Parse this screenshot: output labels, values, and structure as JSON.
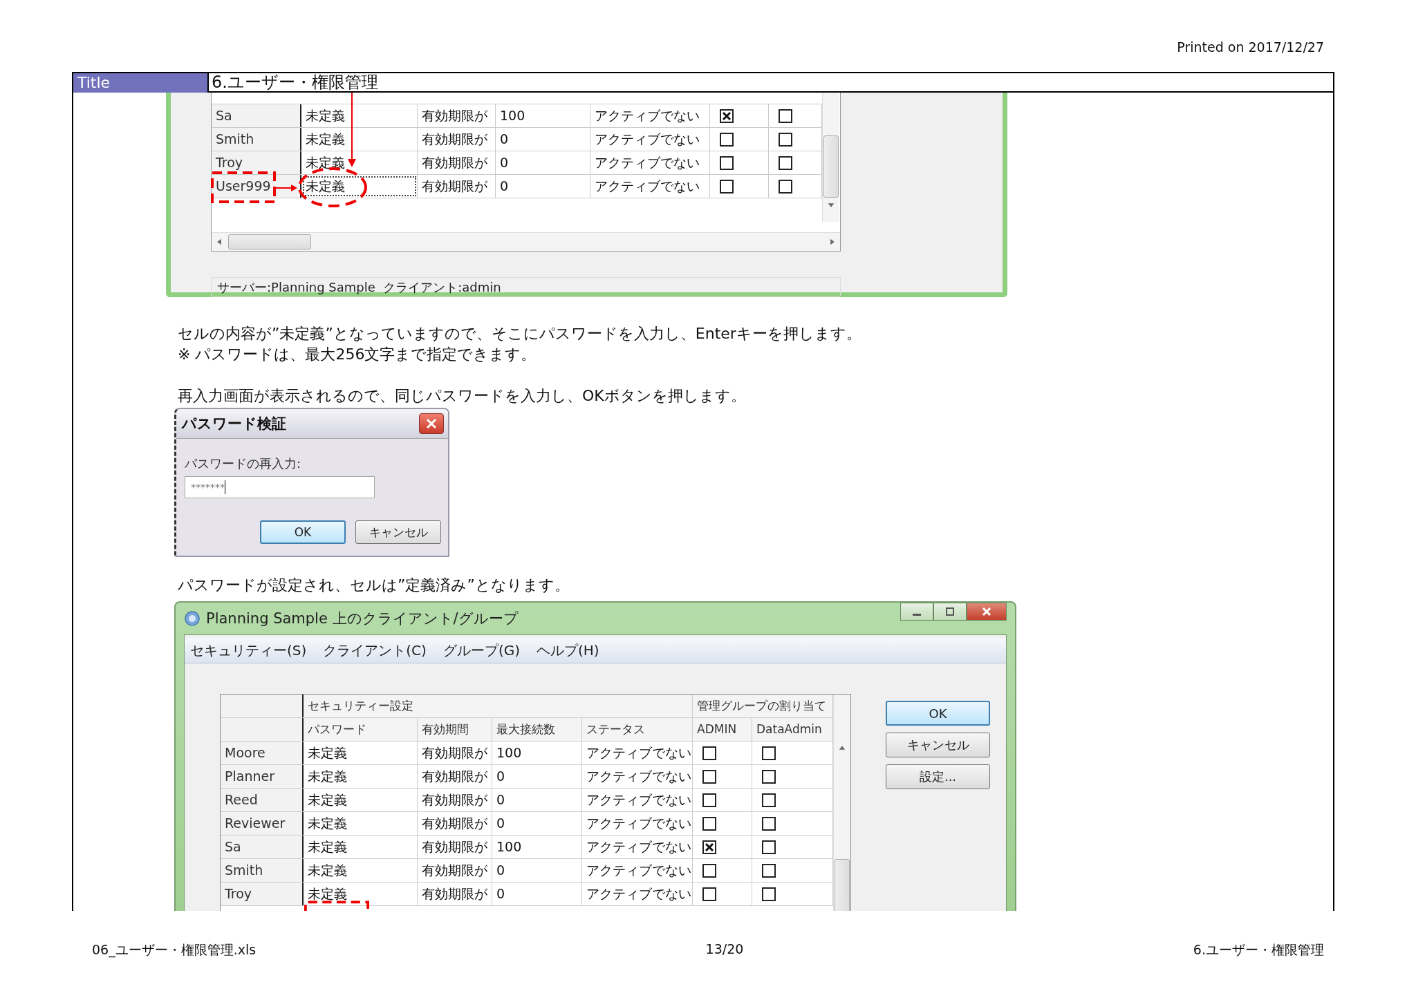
{
  "header": {
    "printed": "Printed on 2017/12/27"
  },
  "title_bar": {
    "label": "Title",
    "title": "6.ユーザー・権限管理"
  },
  "blocks": [
    {
      "kind": "grid_capture",
      "rows": [
        {
          "name": "Sa",
          "password": "未定義",
          "expiry": "有効期限が",
          "max": "100",
          "status": "アクティブでない",
          "admin": true,
          "data_admin": false,
          "focused": false
        },
        {
          "name": "Smith",
          "password": "未定義",
          "expiry": "有効期限が",
          "max": "0",
          "status": "アクティブでない",
          "admin": false,
          "data_admin": false,
          "focused": false
        },
        {
          "name": "Troy",
          "password": "未定義",
          "expiry": "有効期限が",
          "max": "0",
          "status": "アクティブでない",
          "admin": false,
          "data_admin": false,
          "focused": false
        },
        {
          "name": "User999",
          "password": "未定義",
          "expiry": "有効期限が",
          "max": "0",
          "status": "アクティブでない",
          "admin": false,
          "data_admin": false,
          "focused": true
        }
      ],
      "status_bar": "サーバー:Planning Sample  クライアント:admin"
    },
    {
      "kind": "text",
      "lines": [
        "セルの内容が”未定義”となっていますので、そこにパスワードを入力し、Enterキーを押します。",
        "※ パスワードは、最大256文字まで指定できます。"
      ]
    },
    {
      "kind": "text",
      "lines": [
        "再入力画面が表示されるので、同じパスワードを入力し、OKボタンを押します。"
      ]
    },
    {
      "kind": "dialog",
      "title": "パスワード検証",
      "label": "パスワードの再入力:",
      "value": "*******",
      "buttons": [
        {
          "label": "OK",
          "selected": true
        },
        {
          "label": "キャンセル",
          "selected": false
        }
      ]
    },
    {
      "kind": "text",
      "lines": [
        "パスワードが設定され、セルは”定義済み”となります。"
      ]
    },
    {
      "kind": "window",
      "title": "Planning Sample 上のクライアント/グループ",
      "menu": [
        "セキュリティー(S)",
        "クライアント(C)",
        "グループ(G)",
        "ヘルプ(H)"
      ],
      "group_headers": [
        "セキュリティー設定",
        "管理グループの割り当て"
      ],
      "columns": [
        "パスワード",
        "有効期間",
        "最大接続数",
        "ステータス",
        "ADMIN",
        "DataAdmin"
      ],
      "rows": [
        {
          "name": "Moore",
          "password": "未定義",
          "expiry": "有効期限が",
          "max": "100",
          "status": "アクティブでない",
          "admin": false,
          "data_admin": false,
          "focused": false
        },
        {
          "name": "Planner",
          "password": "未定義",
          "expiry": "有効期限が",
          "max": "0",
          "status": "アクティブでない",
          "admin": false,
          "data_admin": false,
          "focused": false
        },
        {
          "name": "Reed",
          "password": "未定義",
          "expiry": "有効期限が",
          "max": "0",
          "status": "アクティブでない",
          "admin": false,
          "data_admin": false,
          "focused": false
        },
        {
          "name": "Reviewer",
          "password": "未定義",
          "expiry": "有効期限が",
          "max": "0",
          "status": "アクティブでない",
          "admin": false,
          "data_admin": false,
          "focused": false
        },
        {
          "name": "Sa",
          "password": "未定義",
          "expiry": "有効期限が",
          "max": "100",
          "status": "アクティブでない",
          "admin": true,
          "data_admin": false,
          "focused": false
        },
        {
          "name": "Smith",
          "password": "未定義",
          "expiry": "有効期限が",
          "max": "0",
          "status": "アクティブでない",
          "admin": false,
          "data_admin": false,
          "focused": false
        },
        {
          "name": "Troy",
          "password": "未定義",
          "expiry": "有効期限が",
          "max": "0",
          "status": "アクティブでない",
          "admin": false,
          "data_admin": false,
          "focused": false
        }
      ],
      "buttons": [
        {
          "label": "OK",
          "selected": true
        },
        {
          "label": "キャンセル",
          "selected": false
        },
        {
          "label": "設定...",
          "selected": false
        }
      ]
    }
  ],
  "footer": {
    "file": "06_ユーザー・権限管理.xls",
    "page": "13/20",
    "sheet": "6.ユーザー・権限管理"
  }
}
